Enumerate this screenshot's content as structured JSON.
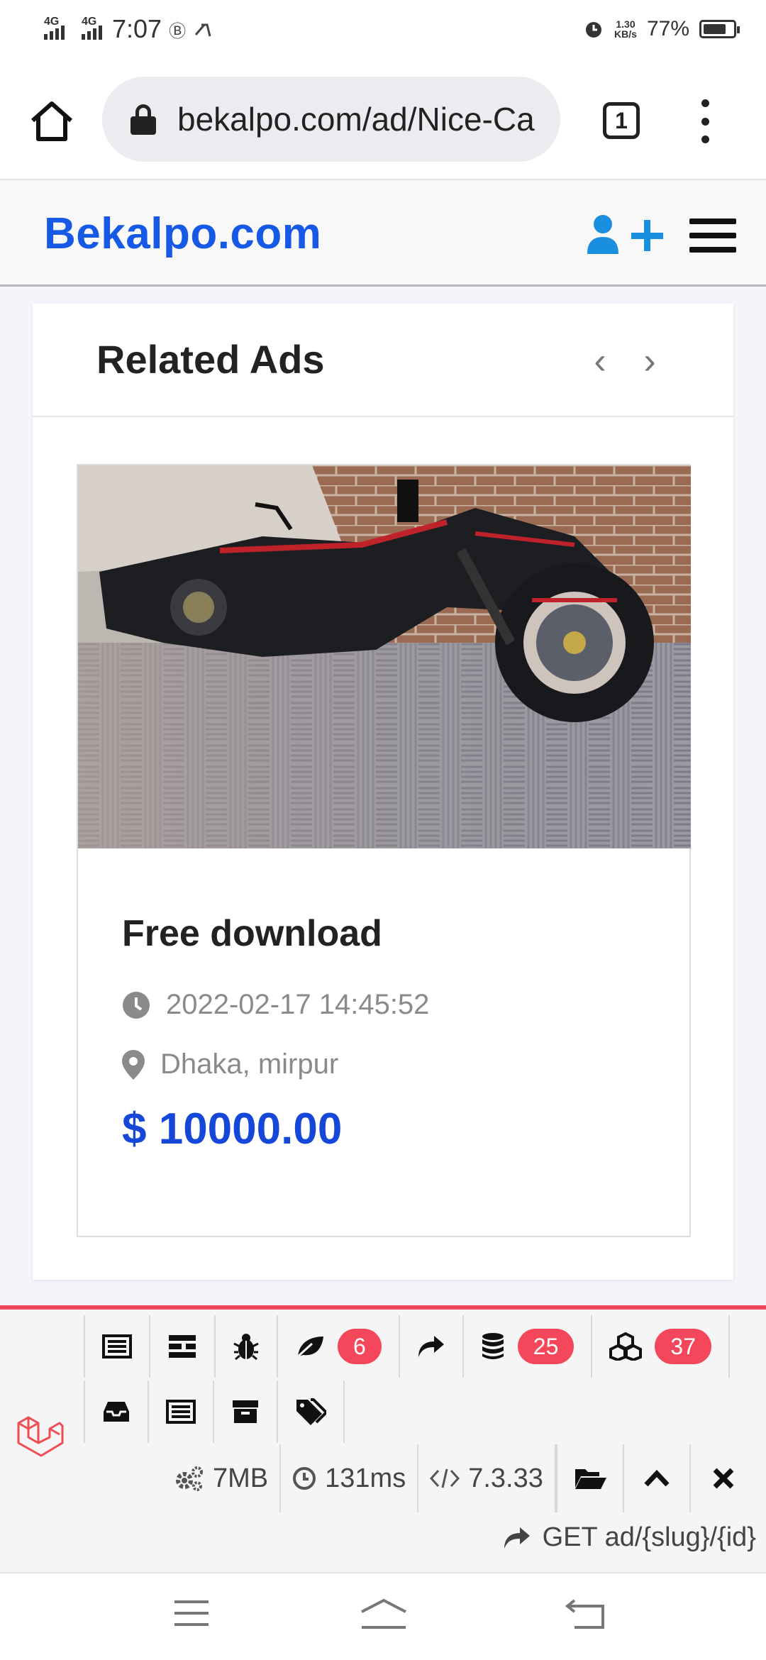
{
  "status_bar": {
    "network_1": "4G",
    "network_2": "4G",
    "time": "7:07",
    "speed_value": "1.30",
    "speed_unit": "KB/s",
    "battery": "77%"
  },
  "browser": {
    "url": "bekalpo.com/ad/Nice-Ca",
    "tab_count": "1"
  },
  "site": {
    "logo": "Bekalpo.com",
    "colors": {
      "brand": "#1659e6",
      "price": "#1547d8",
      "debug_accent": "#f4475b"
    }
  },
  "related": {
    "title": "Related Ads",
    "prev_arrow": "‹",
    "next_arrow": "›",
    "ad": {
      "title": "Free download",
      "date": "2022-02-17 14:45:52",
      "location": "Dhaka, mirpur",
      "price": "$ 10000.00"
    }
  },
  "debugbar": {
    "leaf_badge": "6",
    "database_badge": "25",
    "models_badge": "37",
    "memory": "7MB",
    "duration": "131ms",
    "php_version": "7.3.33",
    "route": "GET ad/{slug}/{id}"
  }
}
